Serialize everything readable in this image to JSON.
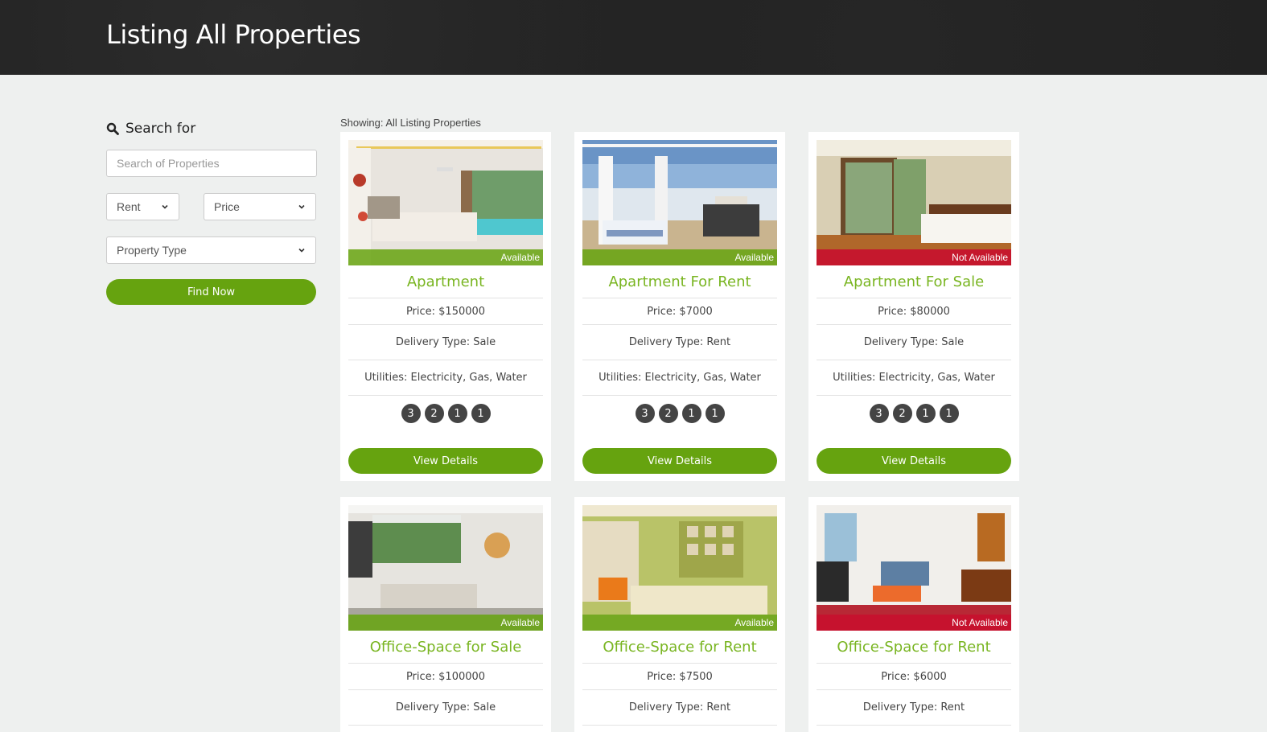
{
  "header": {
    "title": "Listing All Properties"
  },
  "sidebar": {
    "search_title": "Search for",
    "search_placeholder": "Search of Properties",
    "rent_select": "Rent",
    "price_select": "Price",
    "type_select": "Property Type",
    "find_button": "Find Now"
  },
  "main": {
    "showing": "Showing: All Listing Properties",
    "view_label": "View Details",
    "listings": [
      {
        "status": "Available",
        "status_color": "#66a30f",
        "title": "Apartment",
        "price": "Price: $150000",
        "delivery": "Delivery Type: Sale",
        "utilities": "Utilities: Electricity, Gas, Water",
        "badges": [
          "3",
          "2",
          "1",
          "1"
        ]
      },
      {
        "status": "Available",
        "status_color": "#66a30f",
        "title": "Apartment For Rent",
        "price": "Price: $7000",
        "delivery": "Delivery Type: Rent",
        "utilities": "Utilities: Electricity, Gas, Water",
        "badges": [
          "3",
          "2",
          "1",
          "1"
        ]
      },
      {
        "status": "Not Available",
        "status_color": "#c8102e",
        "title": "Apartment For Sale",
        "price": "Price: $80000",
        "delivery": "Delivery Type: Sale",
        "utilities": "Utilities: Electricity, Gas, Water",
        "badges": [
          "3",
          "2",
          "1",
          "1"
        ]
      },
      {
        "status": "Available",
        "status_color": "#66a30f",
        "title": "Office-Space for Sale",
        "price": "Price: $100000",
        "delivery": "Delivery Type: Sale"
      },
      {
        "status": "Available",
        "status_color": "#66a30f",
        "title": "Office-Space for Rent",
        "price": "Price: $7500",
        "delivery": "Delivery Type: Rent"
      },
      {
        "status": "Not Available",
        "status_color": "#c8102e",
        "title": "Office-Space for Rent",
        "price": "Price: $6000",
        "delivery": "Delivery Type: Rent"
      }
    ]
  }
}
